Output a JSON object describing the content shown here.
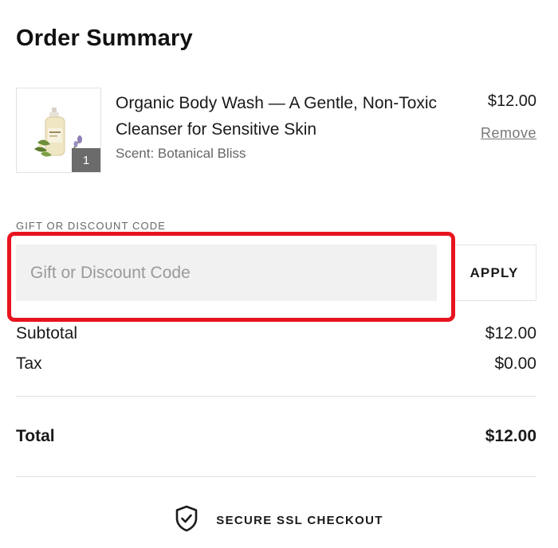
{
  "order": {
    "title": "Order Summary"
  },
  "product": {
    "name": "Organic Body Wash — A Gentle, Non-Toxic Cleanser for Sensitive Skin",
    "variant": "Scent: Botanical Bliss",
    "price": "$12.00",
    "remove_label": "Remove",
    "quantity": "1",
    "image_icon": "product-bottle-image"
  },
  "discount": {
    "label": "GIFT OR DISCOUNT CODE",
    "placeholder": "Gift or Discount Code",
    "value": "",
    "apply_label": "APPLY",
    "highlight_color": "#e8141f"
  },
  "totals": {
    "subtotal_label": "Subtotal",
    "subtotal_value": "$12.00",
    "tax_label": "Tax",
    "tax_value": "$0.00",
    "total_label": "Total",
    "total_value": "$12.00"
  },
  "secure": {
    "label": "SECURE SSL CHECKOUT",
    "icon": "shield-check-icon"
  }
}
